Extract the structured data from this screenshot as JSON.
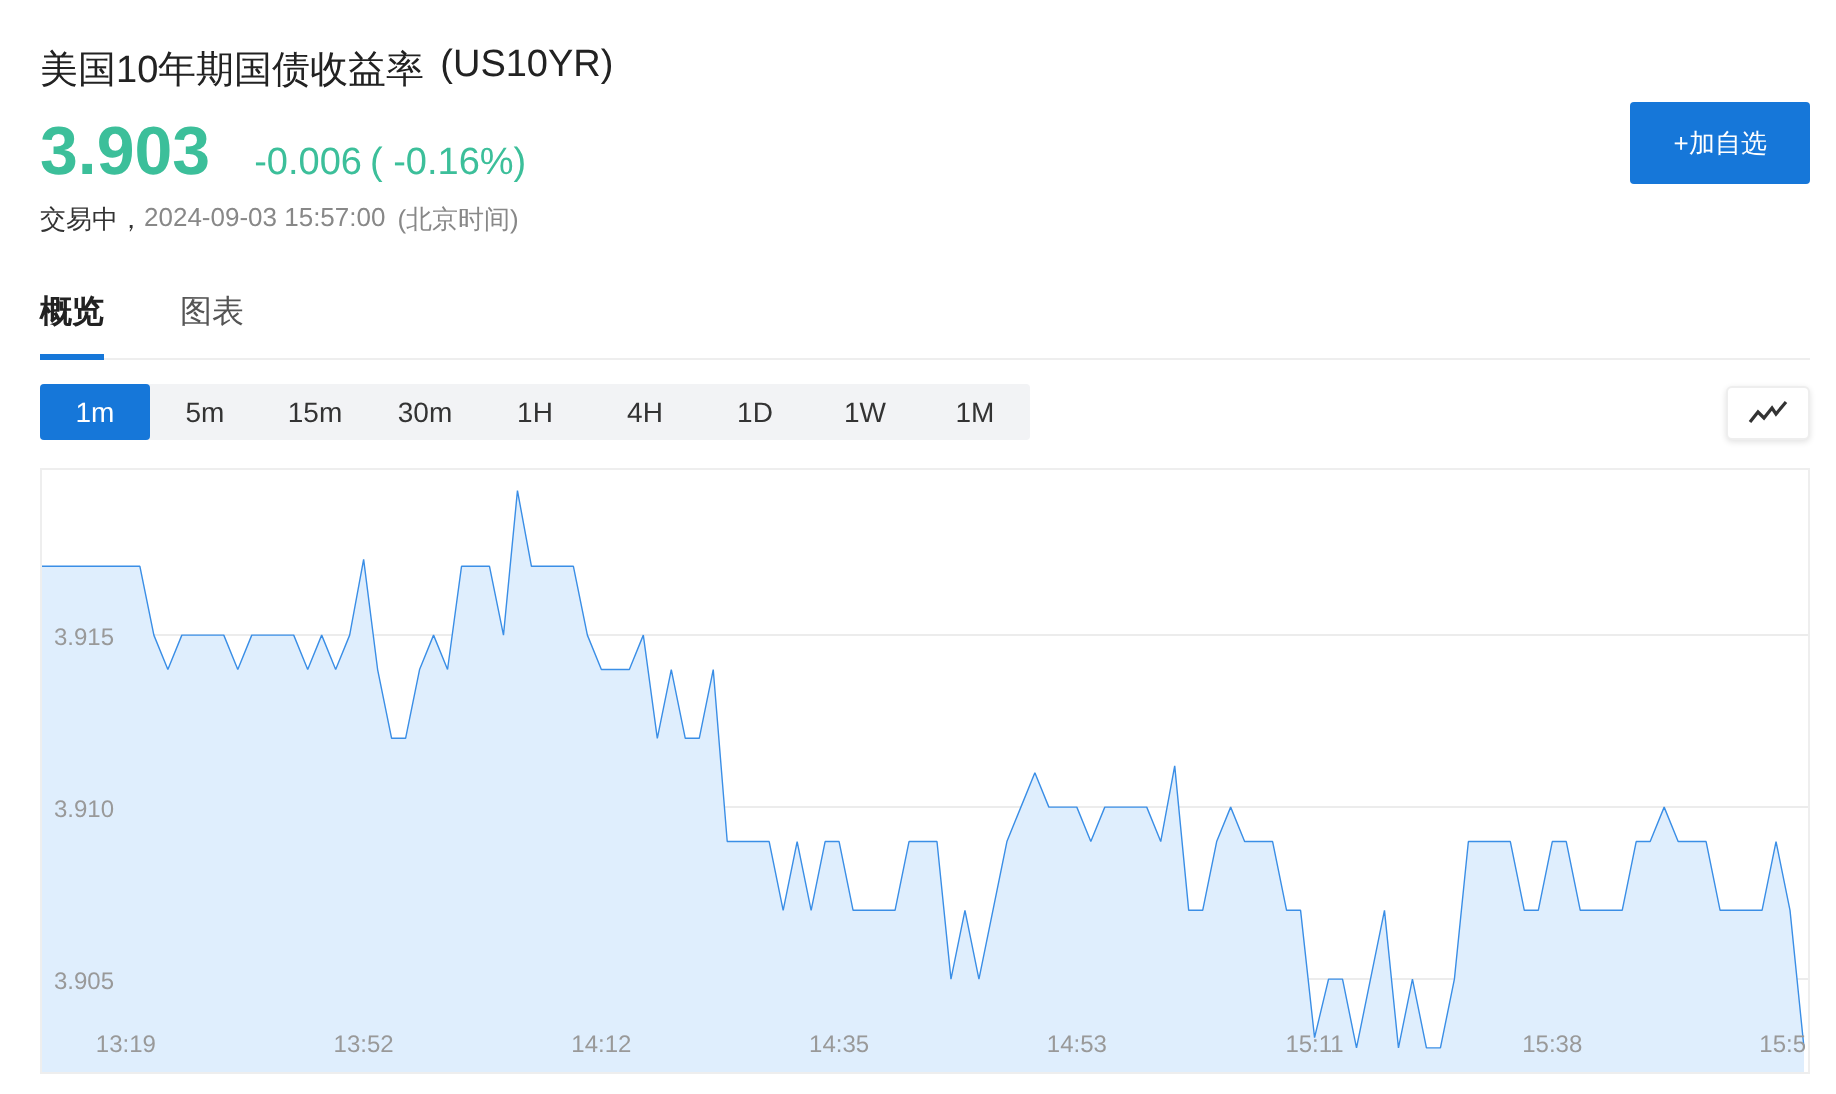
{
  "header": {
    "title": "美国10年期国债收益率",
    "symbol": "(US10YR)",
    "price": "3.903",
    "change": "-0.006",
    "change_pct": "( -0.16%)",
    "status": "交易中，",
    "timestamp": "2024-09-03 15:57:00",
    "timezone": "(北京时间)"
  },
  "add_button": "+加自选",
  "tabs": [
    {
      "label": "概览",
      "selected": true
    },
    {
      "label": "图表",
      "selected": false
    }
  ],
  "periods": [
    {
      "label": "1m",
      "selected": true
    },
    {
      "label": "5m",
      "selected": false
    },
    {
      "label": "15m",
      "selected": false
    },
    {
      "label": "30m",
      "selected": false
    },
    {
      "label": "1H",
      "selected": false
    },
    {
      "label": "4H",
      "selected": false
    },
    {
      "label": "1D",
      "selected": false
    },
    {
      "label": "1W",
      "selected": false
    },
    {
      "label": "1M",
      "selected": false
    }
  ],
  "chart": {
    "chart_data": {
      "type": "area",
      "grid": true,
      "categories": [
        null,
        null,
        null,
        null,
        null,
        null,
        "13:19",
        null,
        null,
        null,
        null,
        null,
        null,
        null,
        null,
        null,
        null,
        null,
        null,
        null,
        null,
        null,
        null,
        "13:52",
        null,
        null,
        null,
        null,
        null,
        null,
        null,
        null,
        null,
        null,
        null,
        null,
        null,
        null,
        null,
        null,
        "14:12",
        null,
        null,
        null,
        null,
        null,
        null,
        null,
        null,
        null,
        null,
        null,
        null,
        null,
        null,
        null,
        null,
        "14:35",
        null,
        null,
        null,
        null,
        null,
        null,
        null,
        null,
        null,
        null,
        null,
        null,
        null,
        null,
        null,
        null,
        "14:53",
        null,
        null,
        null,
        null,
        null,
        null,
        null,
        null,
        null,
        null,
        null,
        null,
        null,
        null,
        null,
        null,
        "15:11",
        null,
        null,
        null,
        null,
        null,
        null,
        null,
        null,
        null,
        null,
        null,
        null,
        null,
        null,
        null,
        null,
        "15:38",
        null,
        null,
        null,
        null,
        null,
        null,
        null,
        null,
        null,
        null,
        null,
        null,
        null,
        null,
        null,
        null,
        "15:5",
        null
      ],
      "series": [
        {
          "color": "#3a8ee6",
          "values": [
            3.917,
            3.917,
            3.917,
            3.917,
            3.917,
            3.917,
            3.917,
            3.917,
            3.915,
            3.914,
            3.915,
            3.915,
            3.915,
            3.915,
            3.914,
            3.915,
            3.915,
            3.915,
            3.915,
            3.914,
            3.915,
            3.914,
            3.915,
            3.9172,
            3.914,
            3.912,
            3.912,
            3.914,
            3.915,
            3.914,
            3.917,
            3.917,
            3.917,
            3.915,
            3.9192,
            3.917,
            3.917,
            3.917,
            3.917,
            3.915,
            3.914,
            3.914,
            3.914,
            3.915,
            3.912,
            3.914,
            3.912,
            3.912,
            3.914,
            3.909,
            3.909,
            3.909,
            3.909,
            3.907,
            3.909,
            3.907,
            3.909,
            3.909,
            3.907,
            3.907,
            3.907,
            3.907,
            3.909,
            3.909,
            3.909,
            3.905,
            3.907,
            3.905,
            3.907,
            3.909,
            3.91,
            3.911,
            3.91,
            3.91,
            3.91,
            3.909,
            3.91,
            3.91,
            3.91,
            3.91,
            3.909,
            3.9112,
            3.907,
            3.907,
            3.909,
            3.91,
            3.909,
            3.909,
            3.909,
            3.907,
            3.907,
            3.9033,
            3.905,
            3.905,
            3.903,
            3.905,
            3.907,
            3.903,
            3.905,
            3.903,
            3.903,
            3.905,
            3.909,
            3.909,
            3.909,
            3.909,
            3.907,
            3.907,
            3.909,
            3.909,
            3.907,
            3.907,
            3.907,
            3.907,
            3.909,
            3.909,
            3.91,
            3.909,
            3.909,
            3.909,
            3.907,
            3.907,
            3.907,
            3.907,
            3.909,
            3.907,
            3.903
          ]
        }
      ],
      "ylim": [
        3.9023,
        3.9198
      ],
      "yticks": [
        {
          "value": 3.905,
          "label": "3.905"
        },
        {
          "value": 3.91,
          "label": "3.910"
        },
        {
          "value": 3.915,
          "label": "3.915"
        }
      ]
    }
  }
}
